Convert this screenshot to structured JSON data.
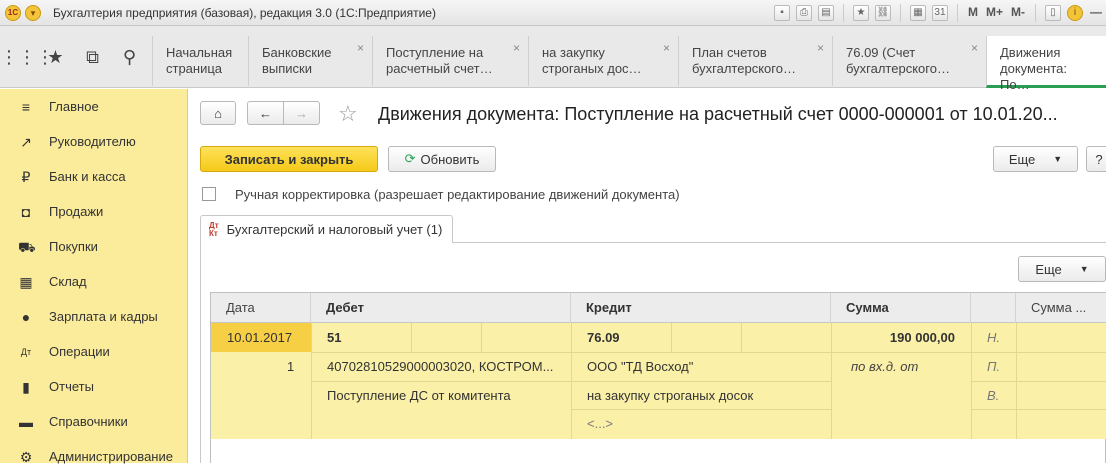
{
  "window": {
    "title": "Бухгалтерия предприятия (базовая), редакция 3.0  (1С:Предприятие)",
    "memory_buttons": [
      "M",
      "M+",
      "M-"
    ]
  },
  "nav": {
    "icons": [
      "apps-grid-icon",
      "favorites-star-icon",
      "history-icon",
      "search-icon"
    ],
    "tabs": [
      {
        "label_line1": "Начальная",
        "label_line2": "страница",
        "closable": false
      },
      {
        "label_line1": "Банковские",
        "label_line2": "выписки",
        "closable": true
      },
      {
        "label_line1": "Поступление на",
        "label_line2": "расчетный счет…",
        "closable": true
      },
      {
        "label_line1": "на закупку",
        "label_line2": "строганых дос…",
        "closable": true
      },
      {
        "label_line1": "План счетов",
        "label_line2": "бухгалтерского…",
        "closable": true
      },
      {
        "label_line1": "76.09 (Счет",
        "label_line2": "бухгалтерского…",
        "closable": true
      },
      {
        "label_line1": "Движения",
        "label_line2": "документа: По…",
        "closable": false,
        "active": true
      }
    ],
    "close_glyph": "×"
  },
  "sidebar": {
    "items": [
      {
        "label": "Главное",
        "icon": "menu-lines-icon"
      },
      {
        "label": "Руководителю",
        "icon": "trend-chart-icon"
      },
      {
        "label": "Банк и касса",
        "icon": "ruble-coin-icon"
      },
      {
        "label": "Продажи",
        "icon": "shopping-bag-icon"
      },
      {
        "label": "Покупки",
        "icon": "cart-icon"
      },
      {
        "label": "Склад",
        "icon": "warehouse-grid-icon"
      },
      {
        "label": "Зарплата и кадры",
        "icon": "person-icon"
      },
      {
        "label": "Операции",
        "icon": "dt-kt-icon"
      },
      {
        "label": "Отчеты",
        "icon": "bar-chart-icon"
      },
      {
        "label": "Справочники",
        "icon": "book-icon"
      },
      {
        "label": "Администрирование",
        "icon": "gear-icon"
      }
    ]
  },
  "main": {
    "title": "Движения документа: Поступление на расчетный счет 0000-000001 от 10.01.20...",
    "buttons": {
      "save_close": "Записать и закрыть",
      "refresh": "Обновить",
      "more": "Еще",
      "help": "?",
      "grid_more": "Еще"
    },
    "manual_correction": {
      "label": "Ручная корректировка (разрешает редактирование движений документа)",
      "checked": false
    },
    "subtab": {
      "icon_text": "Дт Кт",
      "label": "Бухгалтерский и налоговый учет (1)"
    },
    "grid": {
      "columns": [
        "Дата",
        "Дебет",
        "Кредит",
        "Сумма",
        "",
        "Сумма ..."
      ],
      "row": {
        "date": "10.01.2017",
        "number": "1",
        "debit_account": "51",
        "debit_sub1": "40702810529000003020, КОСТРОМ...",
        "debit_sub2": "Поступление ДС от комитента",
        "credit_account": "76.09",
        "credit_sub1": "ООО \"ТД Восход\"",
        "credit_sub2": "на закупку строганых досок",
        "credit_sub3": "<...>",
        "amount": "190 000,00",
        "doc_ref": "по вх.д.  от",
        "flag_n": "Н.",
        "flag_p": "П.",
        "flag_v": "В."
      }
    }
  }
}
